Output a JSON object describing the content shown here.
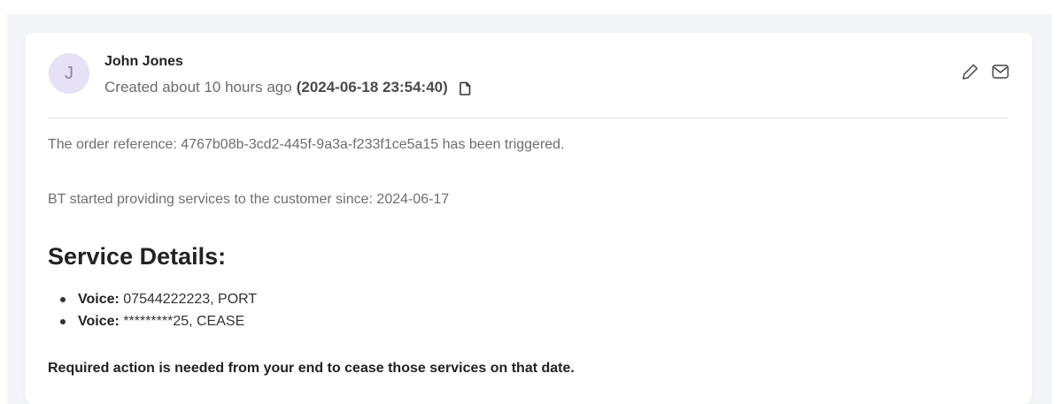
{
  "header": {
    "avatar_initial": "J",
    "author_name": "John Jones",
    "created_relative": "Created about 10 hours ago",
    "created_timestamp": "(2024-06-18 23:54:40)",
    "icons": {
      "copy": "copy-icon",
      "edit": "pencil-icon",
      "email": "mail-icon"
    }
  },
  "body": {
    "order_line": "The order reference: 4767b08b-3cd2-445f-9a3a-f233f1ce5a15 has been triggered.",
    "since_line": "BT started providing services to the customer since: 2024-06-17",
    "section_title": "Service Details:",
    "services": [
      {
        "label": "Voice:",
        "value": " 07544222223, PORT"
      },
      {
        "label": "Voice:",
        "value": " *********25, CEASE"
      }
    ],
    "required_note": "Required action is needed from your end to cease those services on that date."
  },
  "colors": {
    "avatar_bg": "#e6e1f5",
    "avatar_text": "#8a86a8",
    "page_bg": "#f3f4f8",
    "card_bg": "#ffffff"
  }
}
